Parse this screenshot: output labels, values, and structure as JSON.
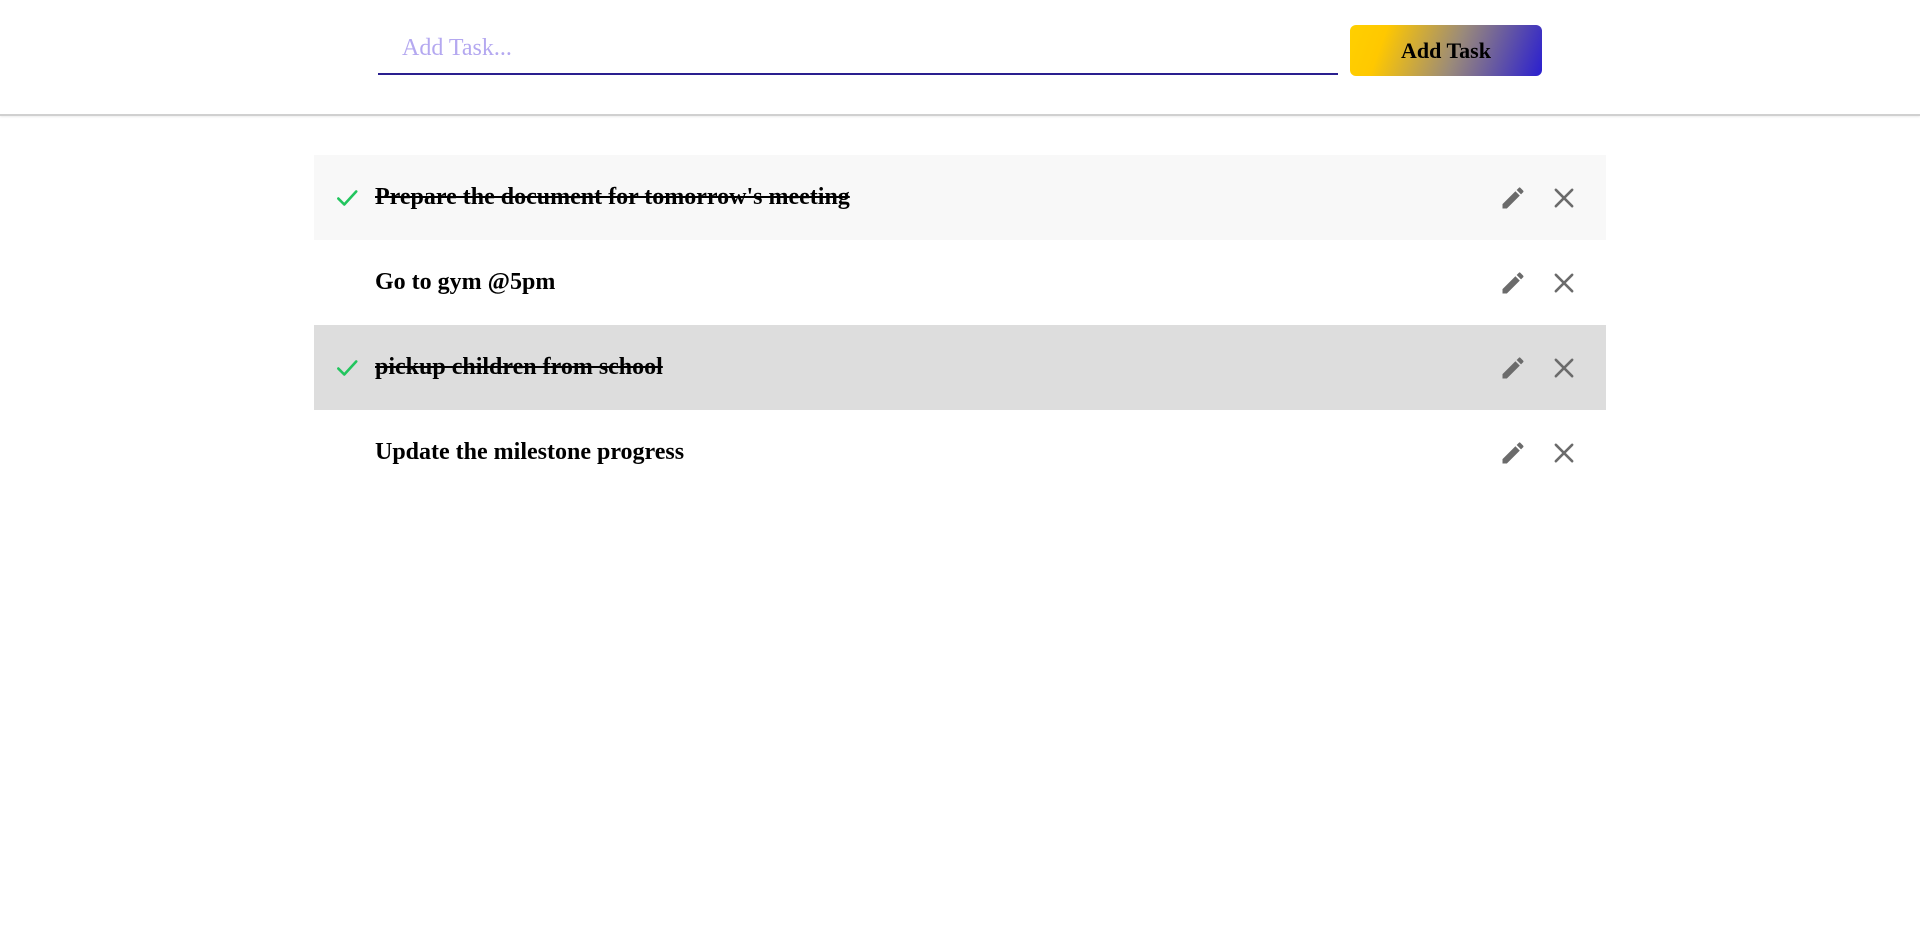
{
  "header": {
    "input_placeholder": "Add Task...",
    "input_value": "",
    "add_button_label": "Add Task"
  },
  "colors": {
    "check": "#22c55e",
    "icon": "#6b6b6b",
    "input_underline": "#2a1f8f",
    "placeholder": "#b4a8f0"
  },
  "tasks": [
    {
      "text": "Prepare the document for tomorrow's meeting",
      "completed": true,
      "icons": [
        "check-icon",
        "pencil-icon",
        "close-icon"
      ]
    },
    {
      "text": "Go to gym @5pm",
      "completed": false,
      "icons": [
        "pencil-icon",
        "close-icon"
      ]
    },
    {
      "text": "pickup children from school",
      "completed": true,
      "icons": [
        "check-icon",
        "pencil-icon",
        "close-icon"
      ]
    },
    {
      "text": "Update the milestone progress",
      "completed": false,
      "icons": [
        "pencil-icon",
        "close-icon"
      ]
    }
  ]
}
